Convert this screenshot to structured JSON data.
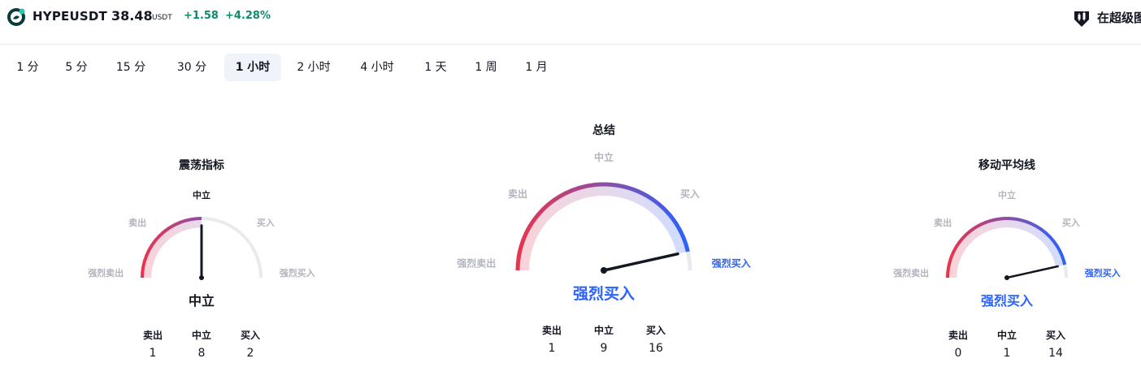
{
  "header": {
    "symbol": "HYPEUSDT",
    "price": "38.48",
    "currency": "USDT",
    "change": "+1.58",
    "change_percent": "+4.28%",
    "promo_text": "在超级图"
  },
  "intervals": [
    {
      "label": "1 分",
      "active": false
    },
    {
      "label": "5 分",
      "active": false
    },
    {
      "label": "15 分",
      "active": false
    },
    {
      "label": "30 分",
      "active": false
    },
    {
      "label": "1 小时",
      "active": true
    },
    {
      "label": "2 小时",
      "active": false
    },
    {
      "label": "4 小时",
      "active": false
    },
    {
      "label": "1 天",
      "active": false
    },
    {
      "label": "1 周",
      "active": false
    },
    {
      "label": "1 月",
      "active": false
    }
  ],
  "gauge_labels": {
    "strong_sell": "强烈卖出",
    "sell": "卖出",
    "neutral": "中立",
    "buy": "买入",
    "strong_buy": "强烈买入"
  },
  "count_labels": {
    "sell": "卖出",
    "neutral": "中立",
    "buy": "买入"
  },
  "oscillators": {
    "title": "震荡指标",
    "result": "中立",
    "needle_value": 0.5,
    "counts": {
      "sell": "1",
      "neutral": "8",
      "buy": "2"
    }
  },
  "summary": {
    "title": "总结",
    "result": "强烈买入",
    "needle_value": 0.93,
    "counts": {
      "sell": "1",
      "neutral": "9",
      "buy": "16"
    }
  },
  "moving_averages": {
    "title": "移动平均线",
    "result": "强烈买入",
    "needle_value": 0.93,
    "counts": {
      "sell": "0",
      "neutral": "1",
      "buy": "14"
    }
  },
  "colors": {
    "sell": "#e8344e",
    "neutral_mid": "#8e4ea3",
    "buy": "#2962ff",
    "track": "#e9eaee",
    "positive": "#0f8a6a"
  }
}
